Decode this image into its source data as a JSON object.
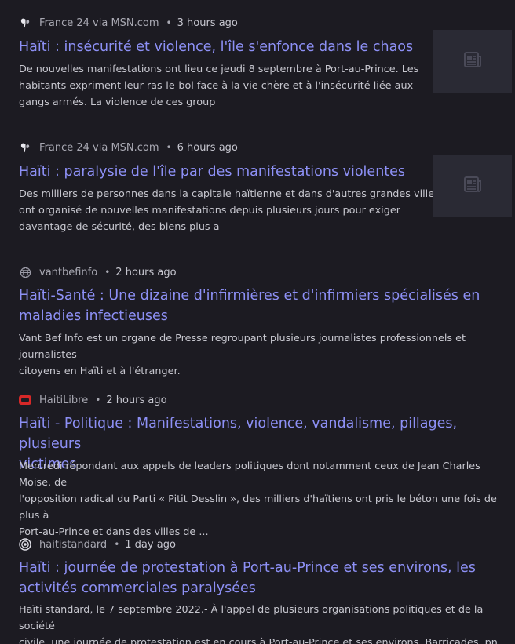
{
  "articles": [
    {
      "source": "France 24 via MSN.com",
      "time": "3 hours ago",
      "source_icon": "butterfly-icon",
      "title_lines": [
        "Haïti : insécurité et violence, l'île s'enfonce dans le chaos"
      ],
      "snippet_lines": [
        "De nouvelles manifestations ont lieu ce jeudi 8 septembre à Port-au-Prince. Les",
        "habitants expriment leur ras-le-bol face à la vie chère et à l'insécurité liée aux",
        "gangs armés. La violence de ces group"
      ],
      "thumbnail_icon": "article-icon"
    },
    {
      "source": "France 24 via MSN.com",
      "time": "6 hours ago",
      "source_icon": "butterfly-icon",
      "title_lines": [
        "Haïti : paralysie de l'île par des manifestations violentes"
      ],
      "snippet_lines": [
        "Des milliers de personnes dans la capitale haïtienne et dans d'autres grandes villes",
        "ont organisé de nouvelles manifestations depuis plusieurs jours pour exiger",
        "davantage de sécurité, des biens plus a"
      ],
      "thumbnail_icon": "article-icon"
    },
    {
      "source": "vantbefinfo",
      "time": "2 hours ago",
      "source_icon": "globe-icon",
      "title_lines": [
        "Haïti-Santé : Une dizaine d'infirmières et d'infirmiers spécialisés en",
        "maladies infectieuses"
      ],
      "snippet_lines": [
        "Vant Bef Info est un organe de Presse regroupant plusieurs journalistes professionnels et journalistes",
        "citoyens en Haïti et à l'étranger."
      ]
    },
    {
      "source": "HaitiLibre",
      "time": "2 hours ago",
      "source_icon": "haitilibre-logo-icon",
      "title_lines": [
        "Haïti - Politique : Manifestations, violence, vandalisme, pillages, plusieurs",
        "victimes"
      ],
      "snippet_lines": [
        "Mercredi répondant aux appels de leaders politiques dont notamment ceux de Jean Charles Moise, de",
        "l'opposition radical du Parti « Pitit Desslin », des milliers d'haïtiens ont pris le béton une fois de plus à",
        "Port-au-Prince et dans des villes de ..."
      ]
    },
    {
      "source": "haitistandard",
      "time": "1 day ago",
      "source_icon": "broadcast-icon",
      "title_lines": [
        "Haïti : journée de protestation à Port-au-Prince et ses environs, les",
        "activités commerciales paralysées"
      ],
      "snippet_lines": [
        "Haïti standard, le 7 septembre 2022.- À l'appel de plusieurs organisations politiques et de la société",
        "civile, une journée de protestation est en cours à Port-au-Prince et ses environs. Barricades, pn"
      ]
    }
  ],
  "separator": "•",
  "colors": {
    "background": "#1c1b22",
    "title_link": "#8d90f5",
    "meta_text": "#a9a9b3",
    "snippet_text": "#c7c7cf",
    "thumbnail_bg": "#2a2a34",
    "haitilibre_red": "#d62828"
  }
}
